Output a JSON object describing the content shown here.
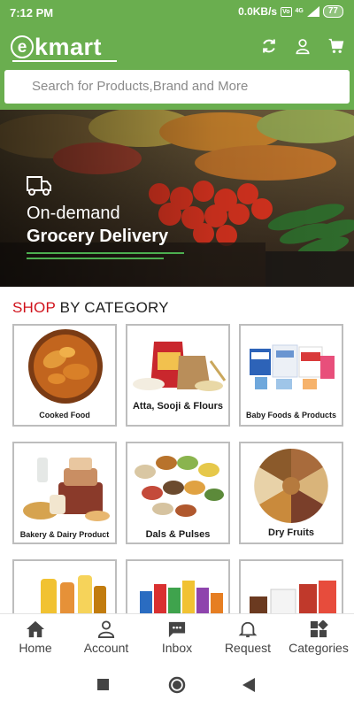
{
  "status_bar": {
    "time": "7:12 PM",
    "network_speed": "0.0KB/s",
    "network_badge": "Vo",
    "signal_label": "4G",
    "battery": "77"
  },
  "app": {
    "logo_letter": "e",
    "logo_text": "kmart"
  },
  "header_icons": [
    "refresh-icon",
    "account-icon",
    "cart-icon"
  ],
  "search": {
    "placeholder": "Search for Products,Brand and More"
  },
  "banner": {
    "line1": "On-demand",
    "line2": "Grocery Delivery"
  },
  "section": {
    "accent": "SHOP",
    "title": " BY CATEGORY"
  },
  "categories": [
    {
      "label": "Cooked Food"
    },
    {
      "label": "Atta, Sooji & Flours"
    },
    {
      "label": "Baby Foods & Products"
    },
    {
      "label": "Bakery & Dairy Product"
    },
    {
      "label": "Dals & Pulses"
    },
    {
      "label": "Dry Fruits"
    }
  ],
  "bottom_nav": [
    {
      "label": "Home",
      "icon": "home-icon"
    },
    {
      "label": "Account",
      "icon": "account-icon"
    },
    {
      "label": "Inbox",
      "icon": "chat-icon"
    },
    {
      "label": "Request",
      "icon": "bell-icon"
    },
    {
      "label": "Categories",
      "icon": "grid-icon"
    }
  ],
  "colors": {
    "brand": "#6aae4f",
    "accent": "#d0121b",
    "tile_border": "#bdbdbd"
  }
}
